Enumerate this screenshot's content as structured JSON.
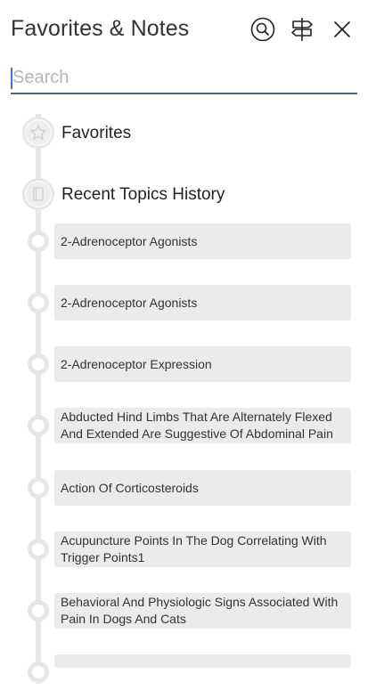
{
  "header": {
    "title": "Favorites & Notes",
    "icons": [
      "search-circle-icon",
      "signpost-icon",
      "close-icon"
    ]
  },
  "search": {
    "placeholder": "Search",
    "value": ""
  },
  "sections": [
    {
      "label": "Favorites",
      "icon": "star-icon"
    },
    {
      "label": "Recent Topics History",
      "icon": "book-icon"
    }
  ],
  "history": [
    {
      "label": "2-Adrenoceptor Agonists"
    },
    {
      "label": "2-Adrenoceptor Agonists"
    },
    {
      "label": "2-Adrenoceptor Expression"
    },
    {
      "label": "Abducted Hind Limbs That Are Alternately Flexed And Extended Are Suggestive Of Abdominal Pain"
    },
    {
      "label": "Action Of Corticosteroids"
    },
    {
      "label": "Acupuncture Points In The Dog Correlating With Trigger Points1"
    },
    {
      "label": "Behavioral And Physiologic Signs Associated With Pain In Dogs And Cats"
    },
    {
      "label": ""
    }
  ]
}
